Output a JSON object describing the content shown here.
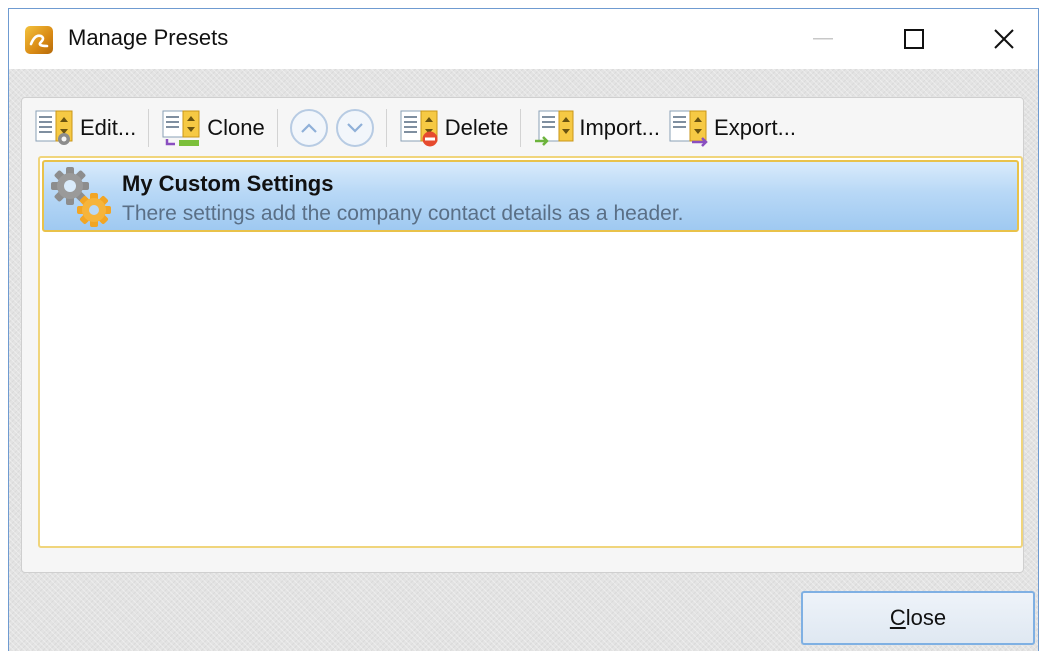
{
  "window": {
    "title": "Manage Presets",
    "accent_border": "#6f9bd1"
  },
  "toolbar": {
    "edit_label": "Edit...",
    "clone_label": "Clone",
    "delete_label": "Delete",
    "import_label": "Import...",
    "export_label": "Export..."
  },
  "presets": {
    "items": [
      {
        "title": "My Custom Settings",
        "description": "There settings add the company contact details as a header."
      }
    ]
  },
  "footer": {
    "close_mnemonic": "C",
    "close_rest": "lose"
  }
}
